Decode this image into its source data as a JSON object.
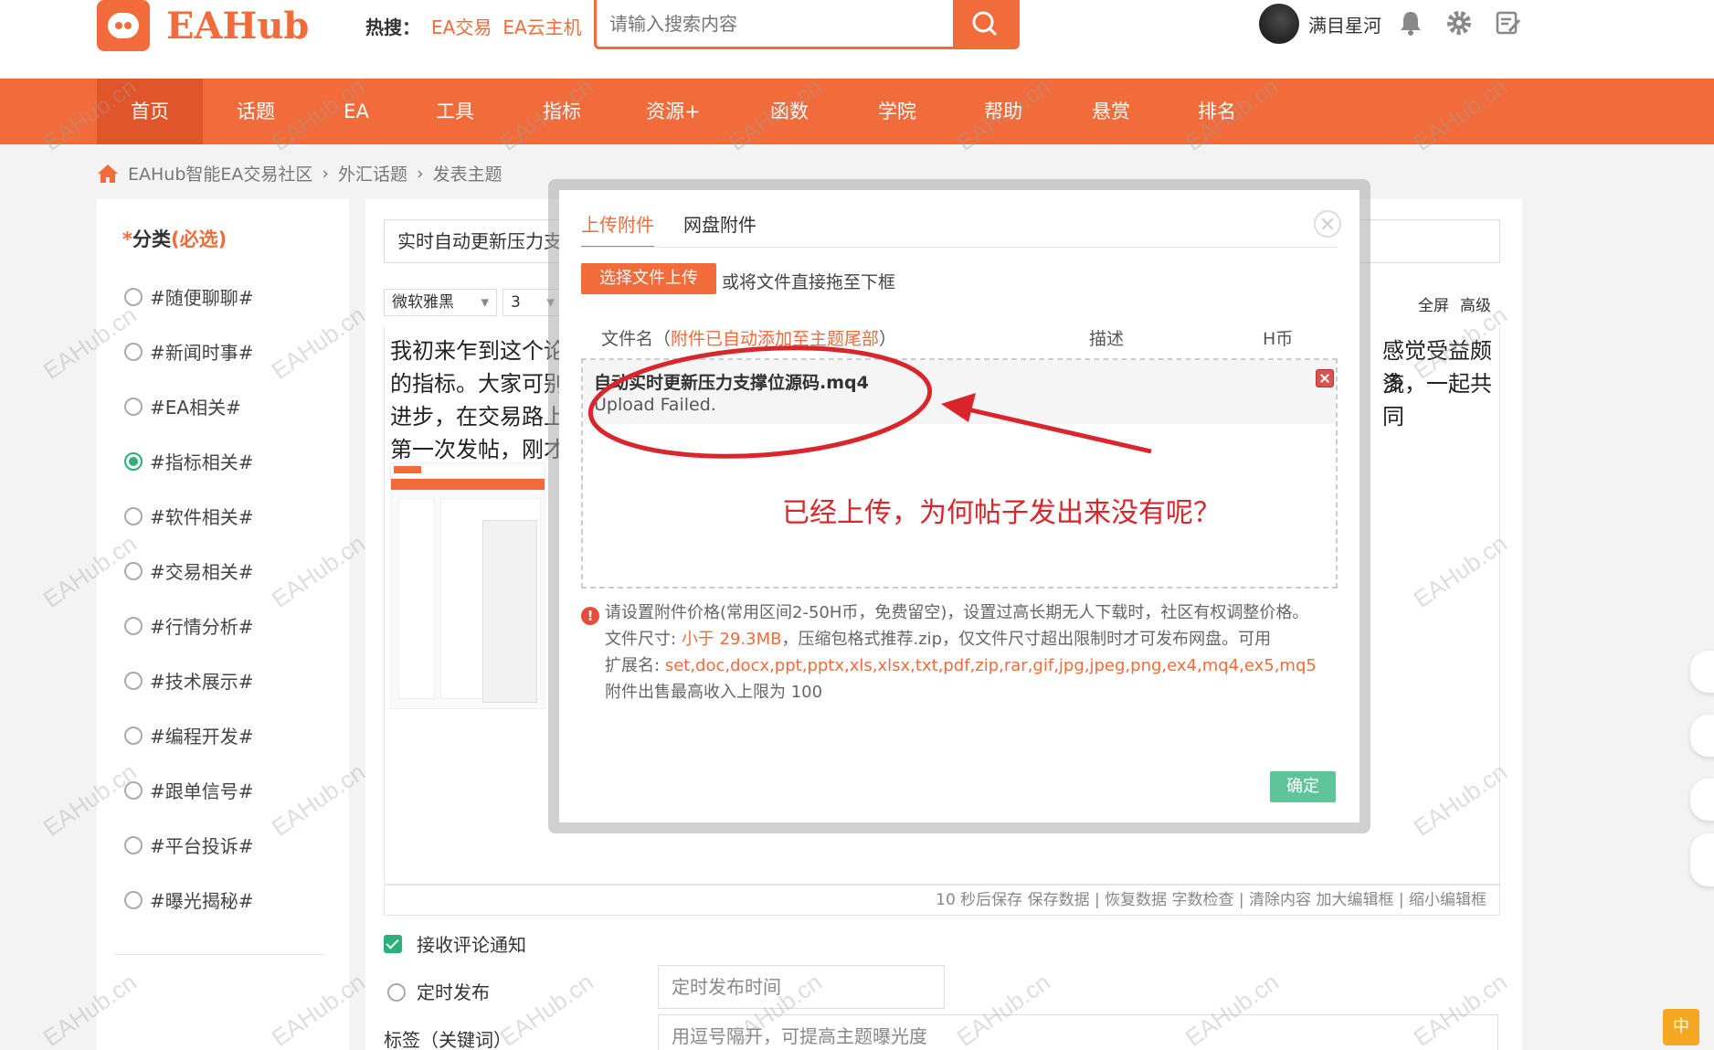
{
  "site": {
    "logo_text": "EAHub",
    "brand_color": "#f26b3a"
  },
  "hot_search": {
    "label": "热搜：",
    "links": [
      "EA交易",
      "EA云主机"
    ]
  },
  "search": {
    "placeholder": "请输入搜索内容"
  },
  "user": {
    "name": "满目星河"
  },
  "nav": [
    "首页",
    "话题",
    "EA",
    "工具",
    "指标",
    "资源+",
    "函数",
    "学院",
    "帮助",
    "悬赏",
    "排名"
  ],
  "breadcrumb": [
    "EAHub智能EA交易社区",
    "外汇话题",
    "发表主题"
  ],
  "sidebar": {
    "title": "分类",
    "required": "(必选)",
    "categories": [
      "#随便聊聊#",
      "#新闻时事#",
      "#EA相关#",
      "#指标相关#",
      "#软件相关#",
      "#交易相关#",
      "#行情分析#",
      "#技术展示#",
      "#编程开发#",
      "#跟单信号#",
      "#平台投诉#",
      "#曝光揭秘#"
    ],
    "selected": "#指标相关#"
  },
  "editor": {
    "title_value": "实时自动更新压力支",
    "font_name": "微软雅黑",
    "font_size": "3",
    "fullscreen": "全屏",
    "advanced": "高级",
    "content_lines_left": [
      "我初来乍到这个论",
      "的指标。大家可别",
      "进步，在交易路上",
      "第一次发帖，刚才"
    ],
    "content_lines_right": [
      "感觉受益颇多",
      "流，一起共同"
    ],
    "status_bar": "10 秒后保存 保存数据 | 恢复数据    字数检查 | 清除内容    加大编辑框 | 缩小编辑框"
  },
  "options": {
    "notify": "接收评论通知",
    "schedule": "定时发布",
    "schedule_placeholder": "定时发布时间",
    "tags_label": "标签（关键词）",
    "tags_placeholder": "用逗号隔开，可提高主题曝光度"
  },
  "modal": {
    "tabs": [
      "上传附件",
      "网盘附件"
    ],
    "upload_button": "选择文件上传",
    "upload_hint": "或将文件直接拖至下框",
    "col_filename": "文件名",
    "col_filename_note": "附件已自动添加至主题尾部",
    "col_desc": "描述",
    "col_price": "H币",
    "file": {
      "name": "自动实时更新压力支撑位源码.mq4",
      "status": "Upload Failed."
    },
    "notice_1": "请设置附件价格(常用区间2-50H币，免费留空)，设置过高长期无人下载时，社区有权调整价格。",
    "notice_size_label": "文件尺寸:",
    "notice_size_value": "小于 29.3MB",
    "notice_size_rest": "，压缩包格式推荐.zip，仅文件尺寸超出限制时才可发布网盘。可用",
    "notice_ext_label": "扩展名:",
    "notice_ext_value": "set,doc,docx,ppt,pptx,xls,xlsx,txt,pdf,zip,rar,gif,jpg,jpeg,png,ex4,mq4,ex5,mq5",
    "notice_limit": "附件出售最高收入上限为 100",
    "confirm": "确定"
  },
  "annotation": {
    "text": "已经上传，为何帖子发出来没有呢？",
    "color": "#d9262c"
  },
  "watermark": "EAHub.cn",
  "ime_label": "中"
}
